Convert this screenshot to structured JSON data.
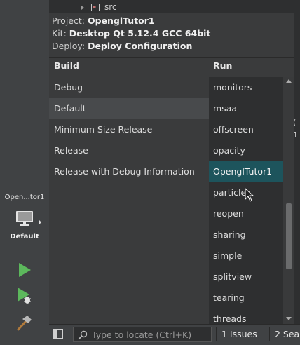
{
  "tree": {
    "folder": "src"
  },
  "popup": {
    "project_label": "Project:",
    "project_value": "OpenglTutor1",
    "kit_label": "Kit:",
    "kit_value": "Desktop Qt 5.12.4 GCC 64bit",
    "deploy_label": "Deploy:",
    "deploy_value": "Deploy Configuration",
    "build_header": "Build",
    "run_header": "Run",
    "build_items": [
      "Debug",
      "Default",
      "Minimum Size Release",
      "Release",
      "Release with Debug Information"
    ],
    "build_selected": "Default",
    "run_items": [
      "monitors",
      "msaa",
      "offscreen",
      "opacity",
      "OpenglTutor1",
      "particles",
      "reopen",
      "sharing",
      "simple",
      "splitview",
      "tearing",
      "threads"
    ],
    "run_selected": "OpenglTutor1"
  },
  "leftbar": {
    "target_project": "Open...tor1",
    "target_config": "Default",
    "icons": [
      "monitor-icon",
      "run-icon",
      "debug-run-icon",
      "build-hammer-icon"
    ]
  },
  "right_strip": {
    "mark1": "(",
    "mark2": "1"
  },
  "bottombar": {
    "locate_placeholder": "Type to locate (Ctrl+K)",
    "issues_tab": "1  Issues",
    "search_tab": "2  Sear"
  },
  "colors": {
    "accent_selected_run": "#1d545c",
    "run_green": "#5cb85c",
    "background": "#2e2f30",
    "panel": "#3a3b3c"
  }
}
